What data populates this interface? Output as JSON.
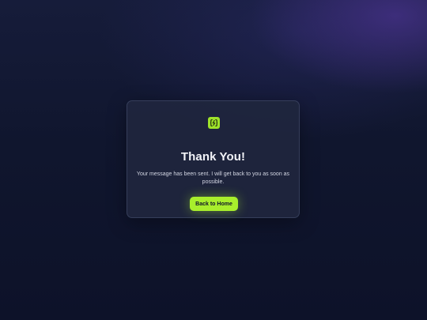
{
  "dialog": {
    "icon": "code-brackets-icon",
    "title": "Thank You!",
    "message": "Your message has been sent. I will get back to you as soon as possible.",
    "button_label": "Back to Home"
  },
  "colors": {
    "accent": "#a8ee2c",
    "background": "#10162e",
    "card": "#20263e",
    "title_text": "#f2f3f8"
  }
}
